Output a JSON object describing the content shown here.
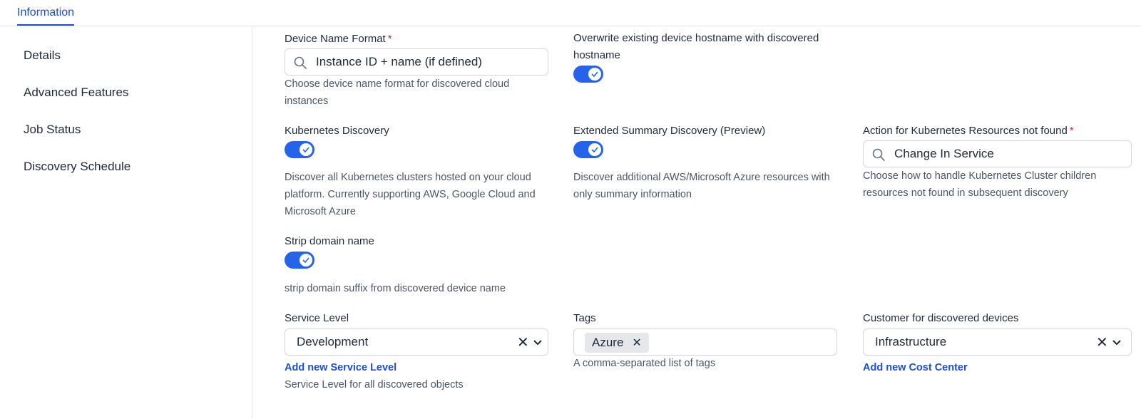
{
  "tabs": {
    "information": "Information"
  },
  "sidebar": {
    "items": [
      {
        "label": "Details"
      },
      {
        "label": "Advanced Features"
      },
      {
        "label": "Job Status"
      },
      {
        "label": "Discovery Schedule"
      }
    ]
  },
  "form": {
    "device_name_format": {
      "label": "Device Name Format",
      "required_mark": "*",
      "value": "Instance ID + name (if defined)",
      "help": "Choose device name format for discovered cloud instances"
    },
    "overwrite_hostname": {
      "label": "Overwrite existing device hostname with discovered hostname",
      "enabled": true
    },
    "kubernetes_discovery": {
      "label": "Kubernetes Discovery",
      "enabled": true,
      "help": "Discover all Kubernetes clusters hosted on your cloud platform. Currently supporting AWS, Google Cloud and Microsoft Azure"
    },
    "extended_summary": {
      "label": "Extended Summary Discovery (Preview)",
      "enabled": true,
      "help": "Discover additional AWS/Microsoft Azure resources with only summary information"
    },
    "k8s_not_found_action": {
      "label": "Action for Kubernetes Resources not found",
      "required_mark": "*",
      "value": "Change In Service",
      "help": "Choose how to handle Kubernetes Cluster children resources not found in subsequent discovery"
    },
    "strip_domain": {
      "label": "Strip domain name",
      "enabled": true,
      "help": "strip domain suffix from discovered device name"
    },
    "service_level": {
      "label": "Service Level",
      "value": "Development",
      "clear_symbol": "✕",
      "add_link": "Add new Service Level",
      "help": "Service Level for all discovered objects"
    },
    "tags": {
      "label": "Tags",
      "chips": [
        "Azure"
      ],
      "chip_remove_symbol": "✕",
      "help": "A comma-separated list of tags"
    },
    "customer": {
      "label": "Customer for discovered devices",
      "value": "Infrastructure",
      "clear_symbol": "✕",
      "add_link": "Add new Cost Center"
    }
  },
  "colors": {
    "accent": "#1d4ed8",
    "toggle_on": "#2563eb",
    "required": "#dc2626"
  },
  "icons": [
    "search-icon",
    "check-icon",
    "close-icon",
    "chevron-down-icon"
  ]
}
